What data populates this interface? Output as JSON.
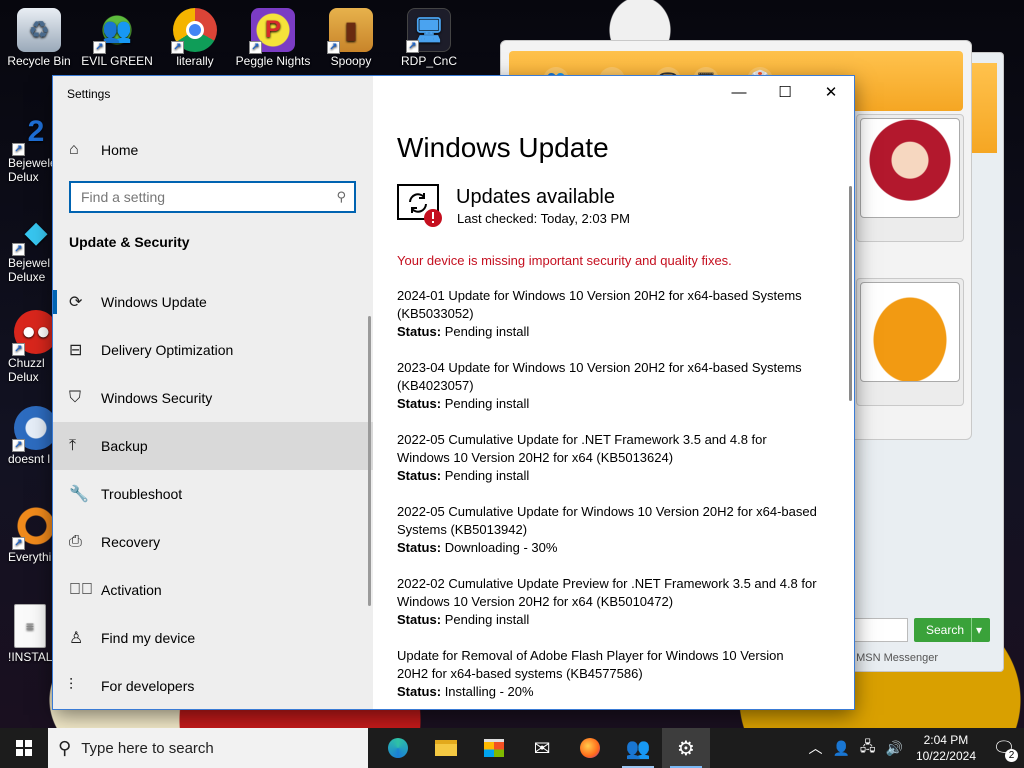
{
  "desktop": {
    "top_icons": [
      {
        "label": "Recycle Bin",
        "icon": "recycle-bin-icon"
      },
      {
        "label": "EVIL GREEN",
        "icon": "messenger-people-icon"
      },
      {
        "label": "literally",
        "icon": "chrome-icon"
      },
      {
        "label": "Peggle Nights",
        "icon": "peggle-icon"
      },
      {
        "label": "Spoopy",
        "icon": "folder-icon"
      },
      {
        "label": "RDP_CnC",
        "icon": "remote-desktop-icon"
      }
    ],
    "left_icons": [
      {
        "label": "Bejewele",
        "label2": "Delux",
        "icon": "bejeweled-icon"
      },
      {
        "label": "Bejewel",
        "label2": "Deluxe",
        "icon": "diamond-icon"
      },
      {
        "label": "Chuzzl",
        "label2": "Delux",
        "icon": "chuzzle-icon"
      },
      {
        "label": "doesnt l",
        "label2": "",
        "icon": "thunderbird-icon"
      },
      {
        "label": "Everythi",
        "label2": "",
        "icon": "everything-search-icon"
      },
      {
        "label": "!INSTALL",
        "label2": "",
        "icon": "text-file-icon"
      }
    ]
  },
  "messenger": {
    "search_label": "Search",
    "footer_text": "f MSN Messenger"
  },
  "settings": {
    "app_title": "Settings",
    "home_label": "Home",
    "search_placeholder": "Find a setting",
    "search_value": "",
    "section_label": "Update & Security",
    "nav": [
      {
        "label": "Windows Update",
        "icon": "sync-icon",
        "active": true
      },
      {
        "label": "Delivery Optimization",
        "icon": "delivery-optimization-icon"
      },
      {
        "label": "Windows Security",
        "icon": "shield-icon"
      },
      {
        "label": "Backup",
        "icon": "backup-upload-icon",
        "hover": true
      },
      {
        "label": "Troubleshoot",
        "icon": "wrench-icon"
      },
      {
        "label": "Recovery",
        "icon": "recovery-icon"
      },
      {
        "label": "Activation",
        "icon": "activation-check-icon"
      },
      {
        "label": "Find my device",
        "icon": "find-device-person-icon"
      },
      {
        "label": "For developers",
        "icon": "developer-sliders-icon"
      }
    ],
    "window_controls": {
      "minimize": "—",
      "maximize": "☐",
      "close": "✕"
    },
    "page_title": "Windows Update",
    "status_heading": "Updates available",
    "last_checked": "Last checked: Today, 2:03 PM",
    "warning": "Your device is missing important security and quality fixes.",
    "status_label": "Status:",
    "updates": [
      {
        "name": "2024-01 Update for Windows 10 Version 20H2 for x64-based Systems (KB5033052)",
        "status": "Pending install"
      },
      {
        "name": "2023-04 Update for Windows 10 Version 20H2 for x64-based Systems (KB4023057)",
        "status": "Pending install"
      },
      {
        "name": "2022-05 Cumulative Update for .NET Framework 3.5 and 4.8 for Windows 10 Version 20H2 for x64 (KB5013624)",
        "status": "Pending install"
      },
      {
        "name": "2022-05 Cumulative Update for Windows 10 Version 20H2 for x64-based Systems (KB5013942)",
        "status": "Downloading - 30%"
      },
      {
        "name": "2022-02 Cumulative Update Preview for .NET Framework 3.5 and 4.8 for Windows 10 Version 20H2 for x64 (KB5010472)",
        "status": "Pending install"
      },
      {
        "name": "Update for Removal of Adobe Flash Player for Windows 10 Version 20H2 for x64-based systems (KB4577586)",
        "status": "Installing - 20%"
      }
    ]
  },
  "taskbar": {
    "search_placeholder": "Type here to search",
    "apps": [
      {
        "icon": "edge-icon",
        "state": "normal"
      },
      {
        "icon": "file-explorer-icon",
        "state": "normal"
      },
      {
        "icon": "microsoft-store-icon",
        "state": "normal"
      },
      {
        "icon": "mail-icon",
        "state": "normal"
      },
      {
        "icon": "firefox-icon",
        "state": "normal"
      },
      {
        "icon": "messenger-people-icon",
        "state": "running"
      },
      {
        "icon": "settings-gear-icon",
        "state": "active"
      }
    ],
    "time": "2:04 PM",
    "date": "10/22/2024",
    "notification_count": "2"
  },
  "colors": {
    "accent": "#0063b1",
    "warning": "#c50f1f",
    "taskbar": "#1c1c1c",
    "sidebar": "#eeeeee"
  }
}
